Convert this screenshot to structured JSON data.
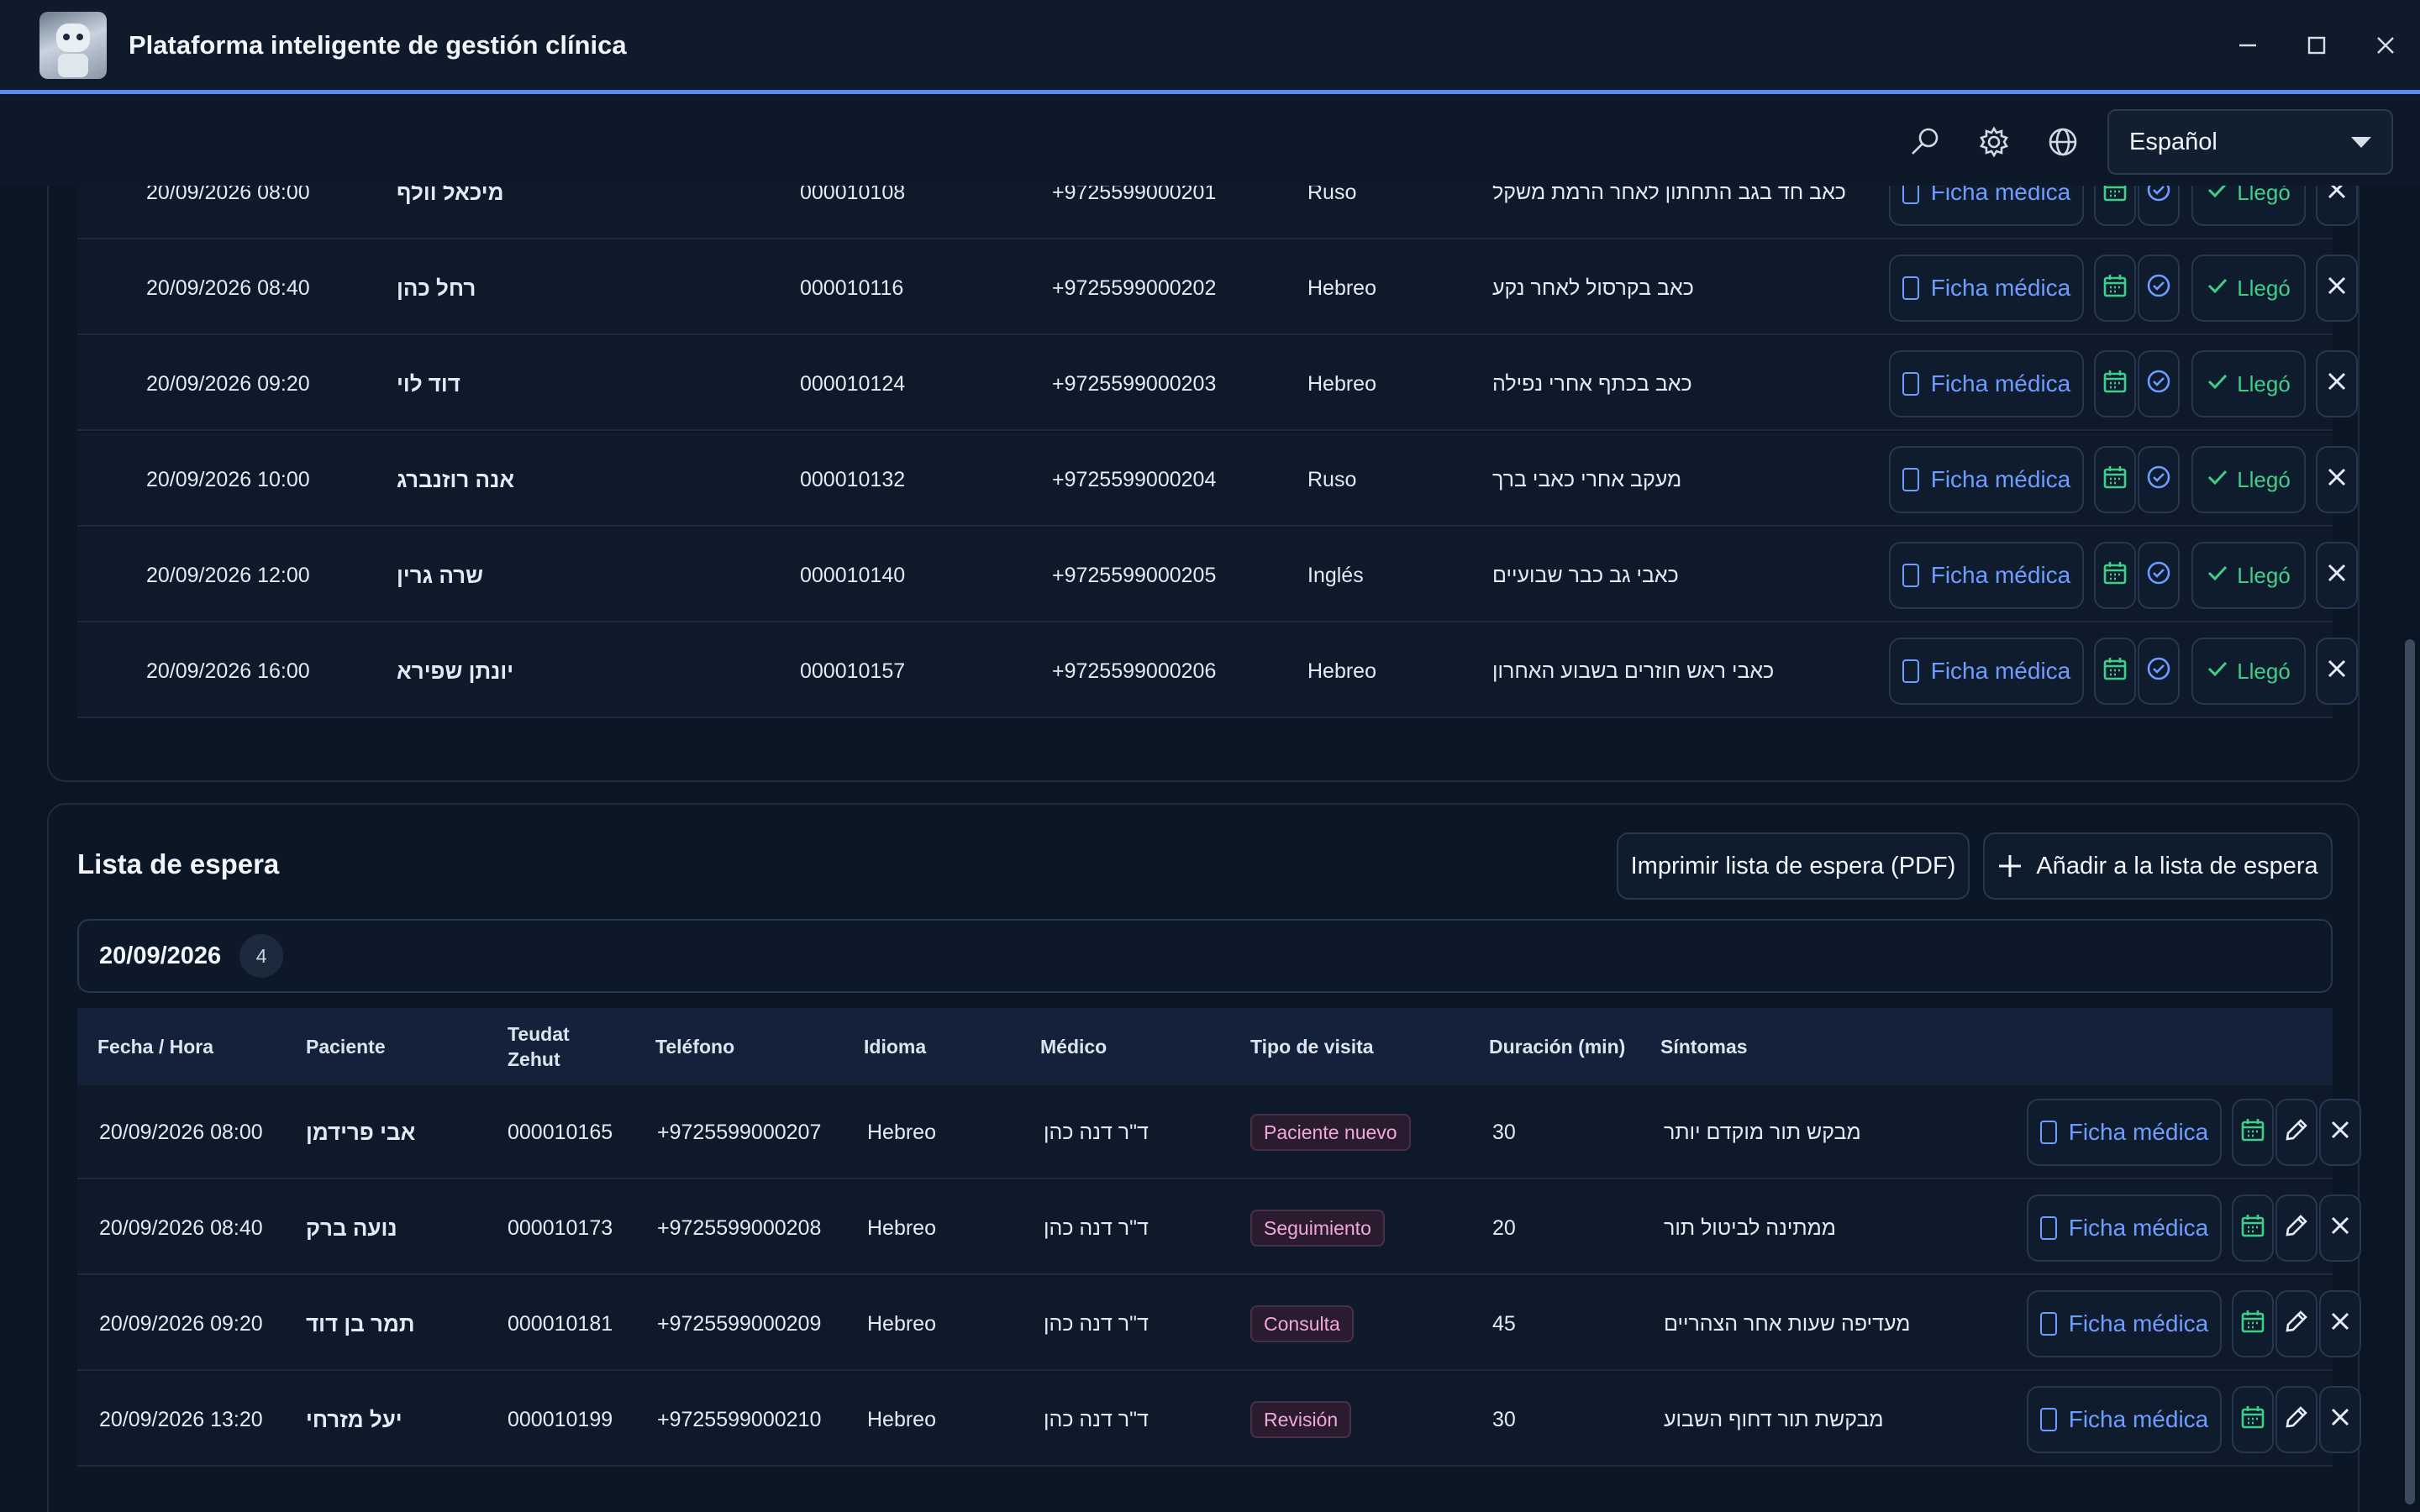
{
  "window": {
    "title": "Plataforma inteligente de gestión clínica",
    "icons": {
      "minimize": "minimize-icon",
      "maximize": "maximize-icon",
      "close": "close-icon"
    }
  },
  "toolbar": {
    "language": "Español",
    "icons": [
      "search-icon",
      "gear-icon",
      "globe-icon"
    ]
  },
  "appointments": {
    "rows": [
      {
        "datetime": "20/09/2026 08:00",
        "patient": "מיכאל וולף",
        "id": "000010108",
        "phone": "+9725599000201",
        "language": "Ruso",
        "reason": "כאב חד בגב התחתון לאחר הרמת משקל"
      },
      {
        "datetime": "20/09/2026 08:40",
        "patient": "רחל כהן",
        "id": "000010116",
        "phone": "+9725599000202",
        "language": "Hebreo",
        "reason": "כאב בקרסול לאחר נקע"
      },
      {
        "datetime": "20/09/2026 09:20",
        "patient": "דוד לוי",
        "id": "000010124",
        "phone": "+9725599000203",
        "language": "Hebreo",
        "reason": "כאב בכתף אחרי נפילה"
      },
      {
        "datetime": "20/09/2026 10:00",
        "patient": "אנה רוזנברג",
        "id": "000010132",
        "phone": "+9725599000204",
        "language": "Ruso",
        "reason": "מעקב אחרי כאבי ברך"
      },
      {
        "datetime": "20/09/2026 12:00",
        "patient": "שרה גרין",
        "id": "000010140",
        "phone": "+9725599000205",
        "language": "Inglés",
        "reason": "כאבי גב כבר שבועיים"
      },
      {
        "datetime": "20/09/2026 16:00",
        "patient": "יונתן שפירא",
        "id": "000010157",
        "phone": "+9725599000206",
        "language": "Hebreo",
        "reason": "כאבי ראש חוזרים בשבוע האחרון"
      }
    ],
    "actions": {
      "record": "Ficha médica",
      "arrived": "Llegó"
    }
  },
  "waitlist": {
    "title": "Lista de espera",
    "print_label": "Imprimir lista de espera (PDF)",
    "add_label": "Añadir a la lista de espera",
    "group_date": "20/09/2026",
    "group_count": "4",
    "headers": {
      "datetime": "Fecha / Hora",
      "patient": "Paciente",
      "id_line1": "Teudat",
      "id_line2": "Zehut",
      "phone": "Teléfono",
      "language": "Idioma",
      "doctor": "Médico",
      "visit_type": "Tipo de visita",
      "duration": "Duración (min)",
      "symptoms": "Síntomas"
    },
    "rows": [
      {
        "datetime": "20/09/2026 08:00",
        "patient": "אבי פרידמן",
        "id": "000010165",
        "phone": "+9725599000207",
        "language": "Hebreo",
        "doctor": "ד\"ר דנה כהן",
        "visit_type": "Paciente nuevo",
        "duration": "30",
        "symptoms": "מבקש תור מוקדם יותר"
      },
      {
        "datetime": "20/09/2026 08:40",
        "patient": "נועה ברק",
        "id": "000010173",
        "phone": "+9725599000208",
        "language": "Hebreo",
        "doctor": "ד\"ר דנה כהן",
        "visit_type": "Seguimiento",
        "duration": "20",
        "symptoms": "ממתינה לביטול תור"
      },
      {
        "datetime": "20/09/2026 09:20",
        "patient": "תמר בן דוד",
        "id": "000010181",
        "phone": "+9725599000209",
        "language": "Hebreo",
        "doctor": "ד\"ר דנה כהן",
        "visit_type": "Consulta",
        "duration": "45",
        "symptoms": "מעדיפה שעות אחר הצהריים"
      },
      {
        "datetime": "20/09/2026 13:20",
        "patient": "יעל מזרחי",
        "id": "000010199",
        "phone": "+9725599000210",
        "language": "Hebreo",
        "doctor": "ד\"ר דנה כהן",
        "visit_type": "Revisión",
        "duration": "30",
        "symptoms": "מבקשת תור דחוף השבוע"
      }
    ],
    "actions": {
      "record": "Ficha médica"
    }
  }
}
